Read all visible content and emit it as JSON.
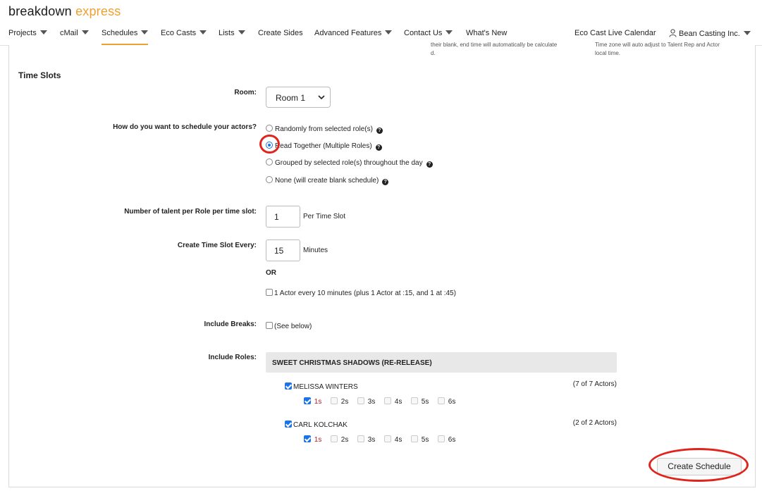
{
  "brand": {
    "part1": "breakdown",
    "part2": "express"
  },
  "nav": {
    "projects": "Projects",
    "cmail": "cMail",
    "schedules": "Schedules",
    "eco_casts": "Eco Casts",
    "lists": "Lists",
    "create_sides": "Create Sides",
    "advanced_features": "Advanced Features",
    "contact_us": "Contact Us",
    "whats_new": "What's New",
    "eco_cast_live_calendar": "Eco Cast Live Calendar",
    "account": "Bean Casting Inc."
  },
  "cutoff_text": {
    "left_line1": "their blank, end time will automatically be calculate",
    "left_line2": "d.",
    "right_line1": "Time zone will auto adjust to Talent Rep and Actor",
    "right_line2": "local time."
  },
  "section_title": "Time Slots",
  "room": {
    "label": "Room:",
    "value": "Room 1"
  },
  "schedule_method": {
    "label": "How do you want to schedule your actors?",
    "options": [
      "Randomly from selected role(s)",
      "Read Together (Multiple Roles)",
      "Grouped by selected role(s) throughout the day",
      "None (will create blank schedule)"
    ],
    "selected": "Read Together (Multiple Roles)"
  },
  "talent_per_role": {
    "label": "Number of talent per Role per time slot:",
    "value": "1",
    "suffix": "Per Time Slot"
  },
  "slot_every": {
    "label": "Create Time Slot Every:",
    "value": "15",
    "suffix": "Minutes",
    "or": "OR"
  },
  "alt_option": {
    "label": "1 Actor every 10 minutes (plus 1 Actor at :15, and 1 at :45)",
    "checked": false
  },
  "breaks": {
    "label": "Include Breaks:",
    "option": "(See below)",
    "checked": false
  },
  "roles": {
    "label": "Include Roles:",
    "project": "SWEET CHRISTMAS SHADOWS (RE-RELEASE)",
    "sizes": [
      "1s",
      "2s",
      "3s",
      "4s",
      "5s",
      "6s"
    ],
    "items": [
      {
        "name": "MELISSA WINTERS",
        "count": "(7 of 7 Actors)",
        "checked": true,
        "checked_size": "1s"
      },
      {
        "name": "CARL KOLCHAK",
        "count": "(2 of 2 Actors)",
        "checked": true,
        "checked_size": "1s"
      }
    ]
  },
  "create_button": "Create Schedule",
  "colors": {
    "brand_orange": "#f0a030",
    "accent_blue": "#1a73e8",
    "highlight_red": "#e0241b",
    "size_red": "#b22222"
  }
}
